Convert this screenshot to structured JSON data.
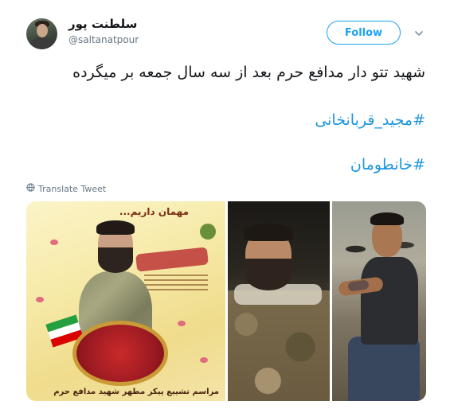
{
  "user": {
    "display_name": "سلطنت پور",
    "handle": "@saltanatpour"
  },
  "follow_label": "Follow",
  "tweet": {
    "text": "شهید تتو دار مدافع حرم بعد از سه سال جمعه بر میگرده",
    "hashtags": [
      "#مجید_قربانخانی",
      "#خانطومان"
    ]
  },
  "translate_label": "Translate Tweet",
  "media": {
    "image1": {
      "top_caption": "مهمان داریم...",
      "bottom_caption": "مراسم تشییع پیکر مطهر شهید مدافع حرم"
    }
  },
  "colors": {
    "accent": "#1da1f2",
    "hashtag": "#1b95e0",
    "text": "#14171a",
    "secondary": "#657786"
  },
  "icons": {
    "caret": "chevron-down-icon",
    "globe": "globe-icon"
  }
}
